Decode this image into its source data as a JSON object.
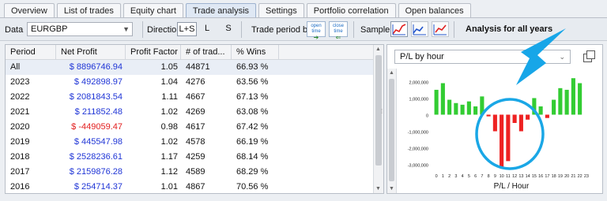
{
  "tabs": [
    {
      "label": "Overview"
    },
    {
      "label": "List of trades"
    },
    {
      "label": "Equity chart"
    },
    {
      "label": "Trade analysis"
    },
    {
      "label": "Settings"
    },
    {
      "label": "Portfolio correlation"
    },
    {
      "label": "Open balances"
    }
  ],
  "toolbar": {
    "data_label": "Data",
    "data_value": "EURGBP",
    "direction_label": "Direction",
    "direction_options": [
      "L+S",
      "L",
      "S"
    ],
    "direction_selected": "L+S",
    "trade_period_label": "Trade period by",
    "period_open_label": "open time",
    "period_close_label": "close time",
    "sample_label": "Sample",
    "analysis_label": "Analysis for all years"
  },
  "table": {
    "headers": [
      "Period",
      "Net Profit",
      "Profit Factor",
      "# of trad...",
      "% Wins"
    ],
    "rows": [
      {
        "period": "All",
        "net_profit": "$ 8896746.94",
        "profit_factor": "1.05",
        "trades": "44871",
        "wins": "66.93 %",
        "negative": false
      },
      {
        "period": "2023",
        "net_profit": "$ 492898.97",
        "profit_factor": "1.04",
        "trades": "4276",
        "wins": "63.56 %",
        "negative": false
      },
      {
        "period": "2022",
        "net_profit": "$ 2081843.54",
        "profit_factor": "1.11",
        "trades": "4667",
        "wins": "67.13 %",
        "negative": false
      },
      {
        "period": "2021",
        "net_profit": "$ 211852.48",
        "profit_factor": "1.02",
        "trades": "4269",
        "wins": "63.08 %",
        "negative": false
      },
      {
        "period": "2020",
        "net_profit": "$ -449059.47",
        "profit_factor": "0.98",
        "trades": "4617",
        "wins": "67.42 %",
        "negative": true
      },
      {
        "period": "2019",
        "net_profit": "$ 445547.98",
        "profit_factor": "1.02",
        "trades": "4578",
        "wins": "66.19 %",
        "negative": false
      },
      {
        "period": "2018",
        "net_profit": "$ 2528236.61",
        "profit_factor": "1.17",
        "trades": "4259",
        "wins": "68.14 %",
        "negative": false
      },
      {
        "period": "2017",
        "net_profit": "$ 2159876.28",
        "profit_factor": "1.12",
        "trades": "4589",
        "wins": "68.29 %",
        "negative": false
      },
      {
        "period": "2016",
        "net_profit": "$ 254714.37",
        "profit_factor": "1.01",
        "trades": "4867",
        "wins": "70.56 %",
        "negative": false
      }
    ]
  },
  "chart_selector": {
    "value": "P/L by hour"
  },
  "colors": {
    "positive": "#33cc33",
    "negative": "#ee2222",
    "accent": "#1aa7e6",
    "link_blue": "#1f35d6"
  },
  "chart_data": {
    "type": "bar",
    "xlabel": "P/L / Hour",
    "categories": [
      "0",
      "1",
      "2",
      "3",
      "4",
      "5",
      "6",
      "7",
      "8",
      "9",
      "10",
      "11",
      "12",
      "13",
      "14",
      "15",
      "16",
      "17",
      "18",
      "19",
      "20",
      "21",
      "22",
      "23"
    ],
    "values": [
      1500000,
      1900000,
      900000,
      700000,
      600000,
      800000,
      500000,
      1100000,
      -100000,
      -1000000,
      -3200000,
      -2800000,
      -500000,
      -1000000,
      -300000,
      1000000,
      500000,
      -200000,
      900000,
      1600000,
      1500000,
      2200000,
      1900000,
      0
    ],
    "yticks": [
      2000000,
      1000000,
      0,
      -1000000,
      -2000000,
      -3000000
    ],
    "ytick_labels": [
      "2,000,000",
      "1,000,000",
      "0",
      "-1,000,000",
      "-2,000,000",
      "-3,000,000"
    ],
    "ylim": [
      -3400000,
      2400000
    ],
    "grid": false,
    "legend": "none"
  }
}
